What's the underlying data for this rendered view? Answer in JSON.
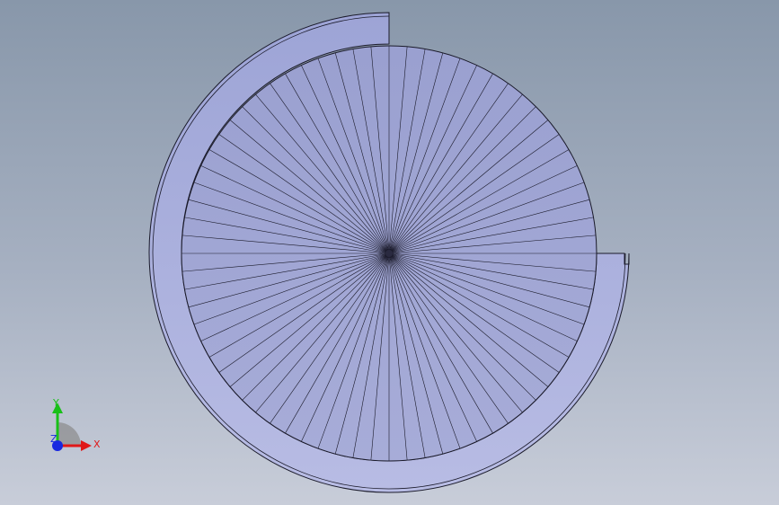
{
  "viewport": {
    "background_top": "#8897aa",
    "background_bottom": "#c8cdd9",
    "model_fill": "#a3a9d8",
    "model_fill_light": "#b4b8e2",
    "edge_color": "#1a1a2a",
    "spoke_count": 72
  },
  "triad": {
    "x_label": "X",
    "y_label": "Y",
    "z_label": "Z",
    "x_color": "#e01818",
    "y_color": "#18c018",
    "z_color": "#1828e0"
  }
}
